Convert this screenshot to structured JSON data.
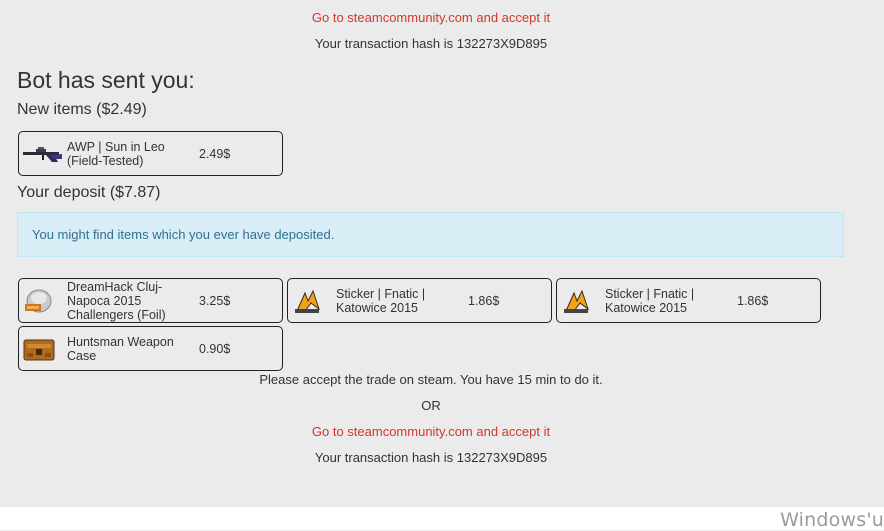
{
  "top": {
    "link_text": "Go to steamcommunity.com and accept it",
    "hash_text": "Your transaction hash is 132273X9D895"
  },
  "bot_sent": {
    "title": "Bot has sent you:",
    "new_items_heading": "New items ($2.49)",
    "new_items": [
      {
        "name": "AWP | Sun in Leo (Field-Tested)",
        "price": "2.49$",
        "icon": "awp-rifle-icon"
      }
    ]
  },
  "deposit": {
    "heading": "Your deposit ($7.87)",
    "info": "You might find items which you ever have deposited.",
    "items": [
      {
        "name": "DreamHack Cluj-Napoca 2015 Challengers (Foil)",
        "price": "3.25$",
        "icon": "sticker-capsule-icon"
      },
      {
        "name": "Sticker | Fnatic | Katowice 2015",
        "price": "1.86$",
        "icon": "fnatic-sticker-icon"
      },
      {
        "name": "Sticker | Fnatic | Katowice 2015",
        "price": "1.86$",
        "icon": "fnatic-sticker-icon"
      },
      {
        "name": "Huntsman Weapon Case",
        "price": "0.90$",
        "icon": "weapon-case-icon"
      }
    ]
  },
  "bottom": {
    "accept_text": "Please accept the trade on steam. You have 15 min to do it.",
    "or_text": "OR",
    "link_text": "Go to steamcommunity.com and accept it",
    "hash_text": "Your transaction hash is 132273X9D895"
  },
  "watermark": "Windows'u",
  "colors": {
    "link": "#d4362c",
    "info_bg": "#d9edf7",
    "info_text": "#31708f",
    "background": "#ebebeb"
  }
}
